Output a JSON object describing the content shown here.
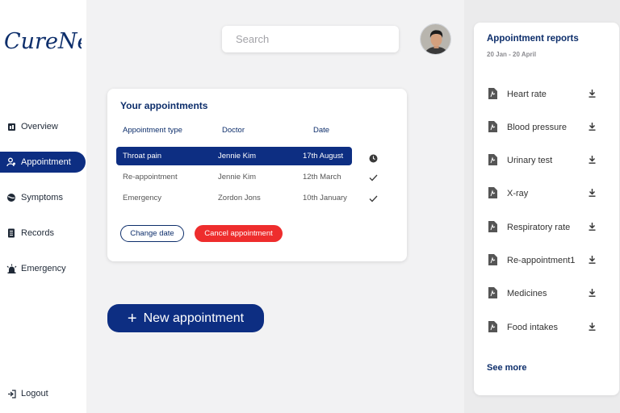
{
  "app": {
    "logo_text": "CureNet"
  },
  "sidebar": {
    "items": [
      {
        "label": "Overview",
        "icon": "overview-icon"
      },
      {
        "label": "Appointment",
        "icon": "appointment-icon",
        "active": true
      },
      {
        "label": "Symptoms",
        "icon": "symptoms-icon"
      },
      {
        "label": "Records",
        "icon": "records-icon"
      },
      {
        "label": "Emergency",
        "icon": "emergency-icon"
      }
    ],
    "logout": {
      "label": "Logout",
      "icon": "logout-icon"
    }
  },
  "header": {
    "search": {
      "placeholder": "Search",
      "value": ""
    }
  },
  "appointments": {
    "title": "Your appointments",
    "columns": [
      "Appointment type",
      "Doctor",
      "Date"
    ],
    "rows": [
      {
        "type": "Throat pain",
        "doctor": "Jennie Kim",
        "date": "17th August",
        "status": "clock-icon",
        "selected": true
      },
      {
        "type": "Re-appointment",
        "doctor": "Jennie Kim",
        "date": "12th March",
        "status": "check-icon"
      },
      {
        "type": "Emergency",
        "doctor": "Zordon Jons",
        "date": "10th January",
        "status": "check-icon"
      }
    ],
    "change_label": "Change date",
    "cancel_label": "Cancel appointment"
  },
  "new_appointment": {
    "label": "New appointment",
    "icon": "plus-icon"
  },
  "reports": {
    "title": "Appointment reports",
    "date_range": "20 Jan - 20 April",
    "items": [
      "Heart rate",
      "Blood pressure",
      "Urinary test",
      "X-ray",
      "Respiratory rate",
      "Re-appointment1",
      "Medicines",
      "Food intakes"
    ],
    "see_more": "See more"
  },
  "colors": {
    "brand": "#0d2e82",
    "danger": "#ee2d2d",
    "heading": "#0d2e6b"
  }
}
